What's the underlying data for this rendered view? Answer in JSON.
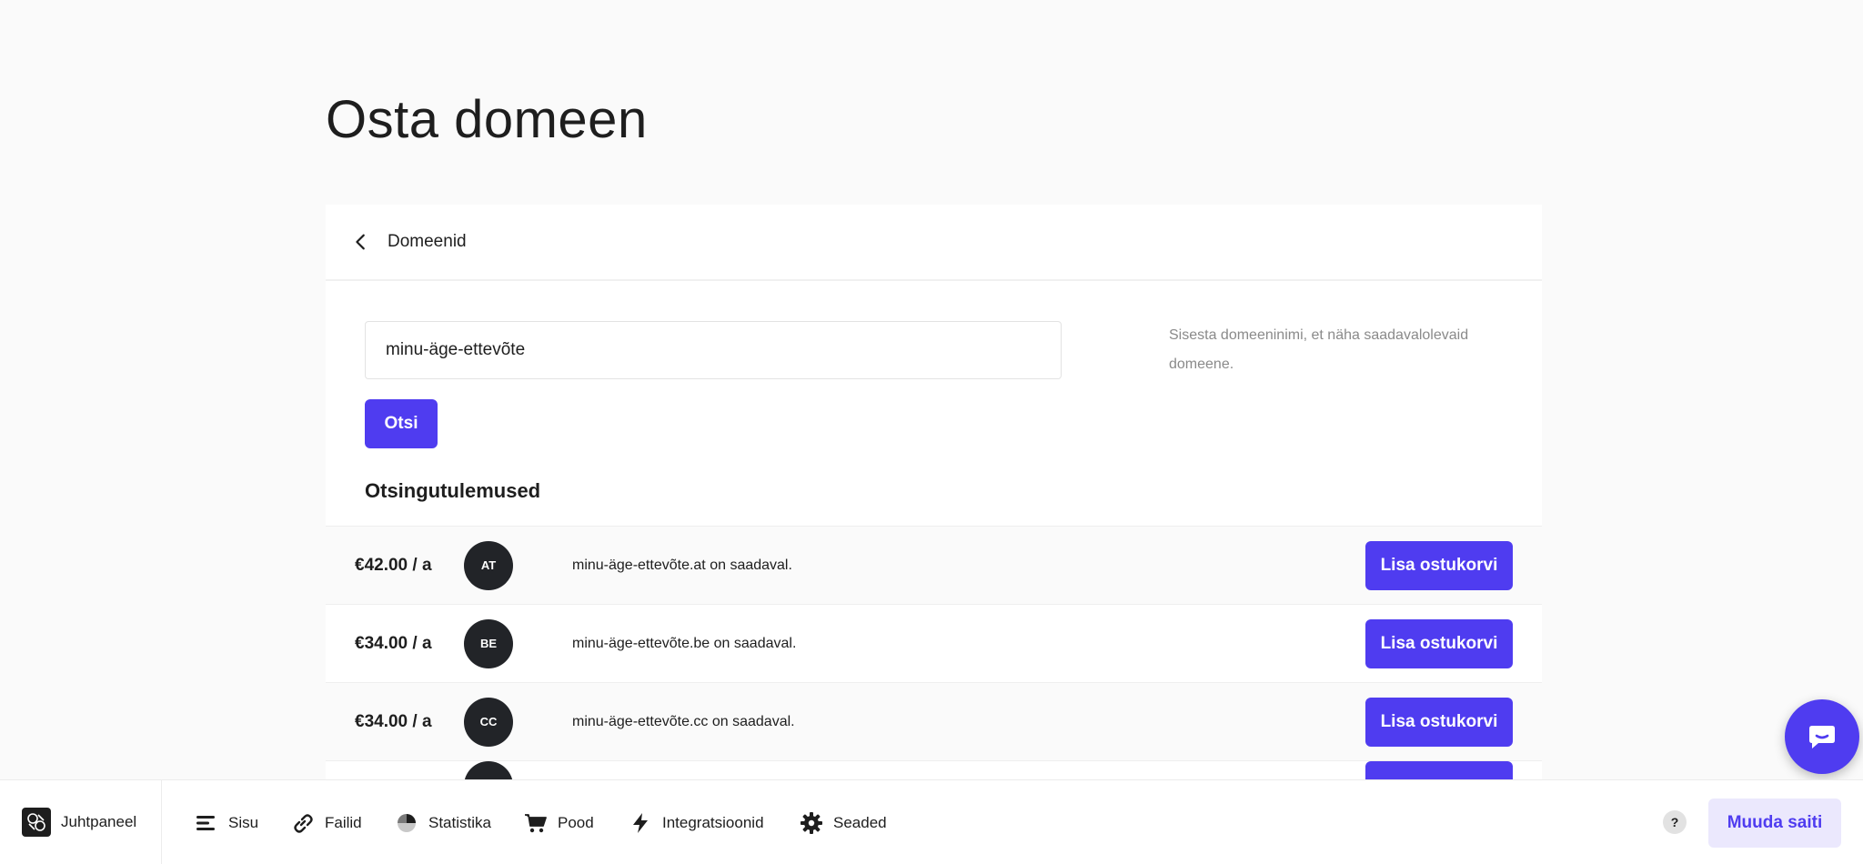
{
  "page": {
    "title": "Osta domeen"
  },
  "card": {
    "back_label": "Domeenid",
    "search": {
      "value": "minu-äge-ettevõte",
      "button_label": "Otsi"
    },
    "hint": "Sisesta domeeninimi, et näha saadavalolevaid domeene.",
    "results_title": "Otsingutulemused",
    "results": [
      {
        "price": "€42.00 / a",
        "tld": "AT",
        "text": "minu-äge-ettevõte.at on saadaval.",
        "button": "Lisa ostukorvi"
      },
      {
        "price": "€34.00 / a",
        "tld": "BE",
        "text": "minu-äge-ettevõte.be on saadaval.",
        "button": "Lisa ostukorvi"
      },
      {
        "price": "€34.00 / a",
        "tld": "CC",
        "text": "minu-äge-ettevõte.cc on saadaval.",
        "button": "Lisa ostukorvi"
      }
    ]
  },
  "bottom_bar": {
    "dashboard": "Juhtpaneel",
    "nav": [
      {
        "label": "Sisu",
        "icon": "content-icon"
      },
      {
        "label": "Failid",
        "icon": "link-icon"
      },
      {
        "label": "Statistika",
        "icon": "pie-chart-icon"
      },
      {
        "label": "Pood",
        "icon": "cart-icon"
      },
      {
        "label": "Integratsioonid",
        "icon": "lightning-icon"
      },
      {
        "label": "Seaded",
        "icon": "gear-icon"
      }
    ],
    "help": "?",
    "edit_site": "Muuda saiti"
  },
  "colors": {
    "accent": "#4f3cf0",
    "accent_light": "#ebe8fd",
    "badge": "#222428",
    "background": "#fafafa"
  }
}
